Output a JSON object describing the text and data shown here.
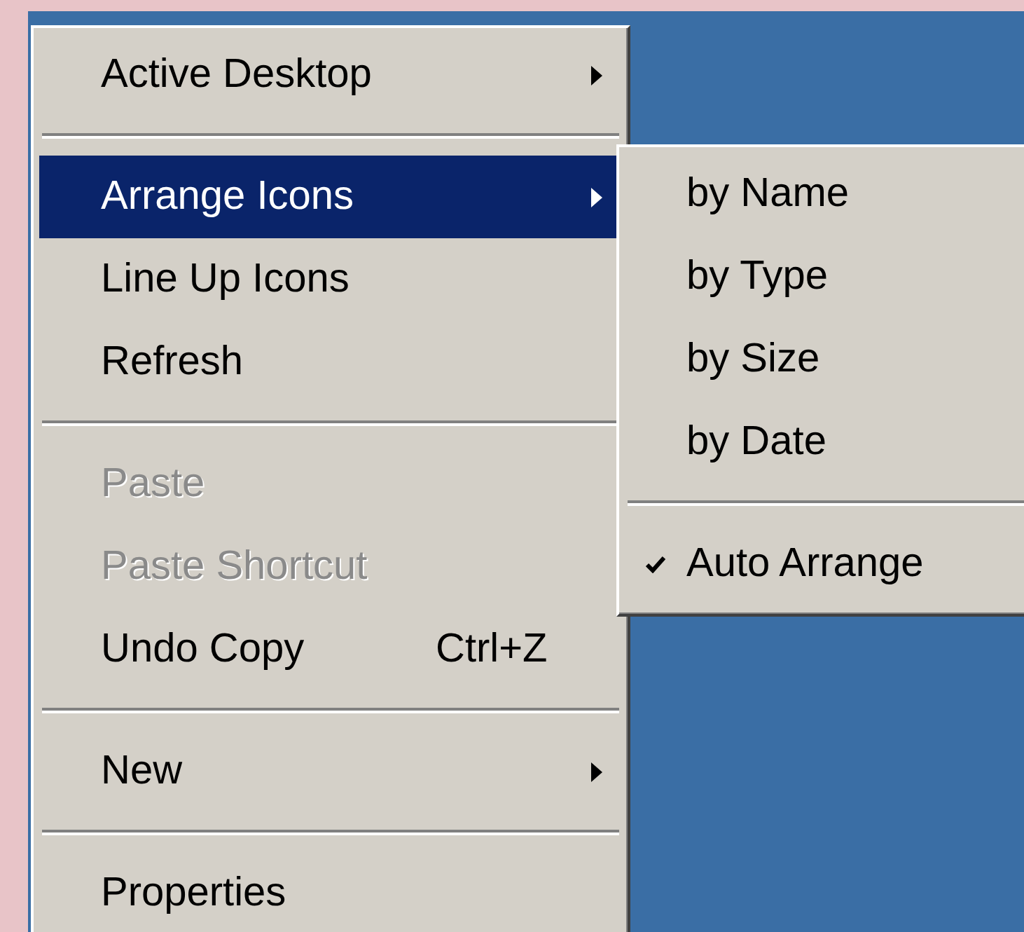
{
  "menu": {
    "items": [
      {
        "kind": "item",
        "label": "Active Desktop",
        "opens_submenu": true,
        "selected": false,
        "disabled": false
      },
      {
        "kind": "separator"
      },
      {
        "kind": "item",
        "label": "Arrange Icons",
        "opens_submenu": true,
        "selected": true,
        "disabled": false
      },
      {
        "kind": "item",
        "label": "Line Up Icons",
        "opens_submenu": false,
        "selected": false,
        "disabled": false
      },
      {
        "kind": "item",
        "label": "Refresh",
        "opens_submenu": false,
        "selected": false,
        "disabled": false
      },
      {
        "kind": "separator"
      },
      {
        "kind": "item",
        "label": "Paste",
        "opens_submenu": false,
        "selected": false,
        "disabled": true
      },
      {
        "kind": "item",
        "label": "Paste Shortcut",
        "opens_submenu": false,
        "selected": false,
        "disabled": true
      },
      {
        "kind": "item",
        "label": "Undo Copy",
        "shortcut": "Ctrl+Z",
        "opens_submenu": false,
        "selected": false,
        "disabled": false
      },
      {
        "kind": "separator"
      },
      {
        "kind": "item",
        "label": "New",
        "opens_submenu": true,
        "selected": false,
        "disabled": false
      },
      {
        "kind": "separator"
      },
      {
        "kind": "item",
        "label": "Properties",
        "opens_submenu": false,
        "selected": false,
        "disabled": false
      }
    ]
  },
  "submenu": {
    "items": [
      {
        "kind": "item",
        "label": "by Name",
        "checked": false
      },
      {
        "kind": "item",
        "label": "by Type",
        "checked": false
      },
      {
        "kind": "item",
        "label": "by Size",
        "checked": false
      },
      {
        "kind": "item",
        "label": "by Date",
        "checked": false
      },
      {
        "kind": "separator"
      },
      {
        "kind": "item",
        "label": "Auto Arrange",
        "checked": true
      }
    ]
  }
}
